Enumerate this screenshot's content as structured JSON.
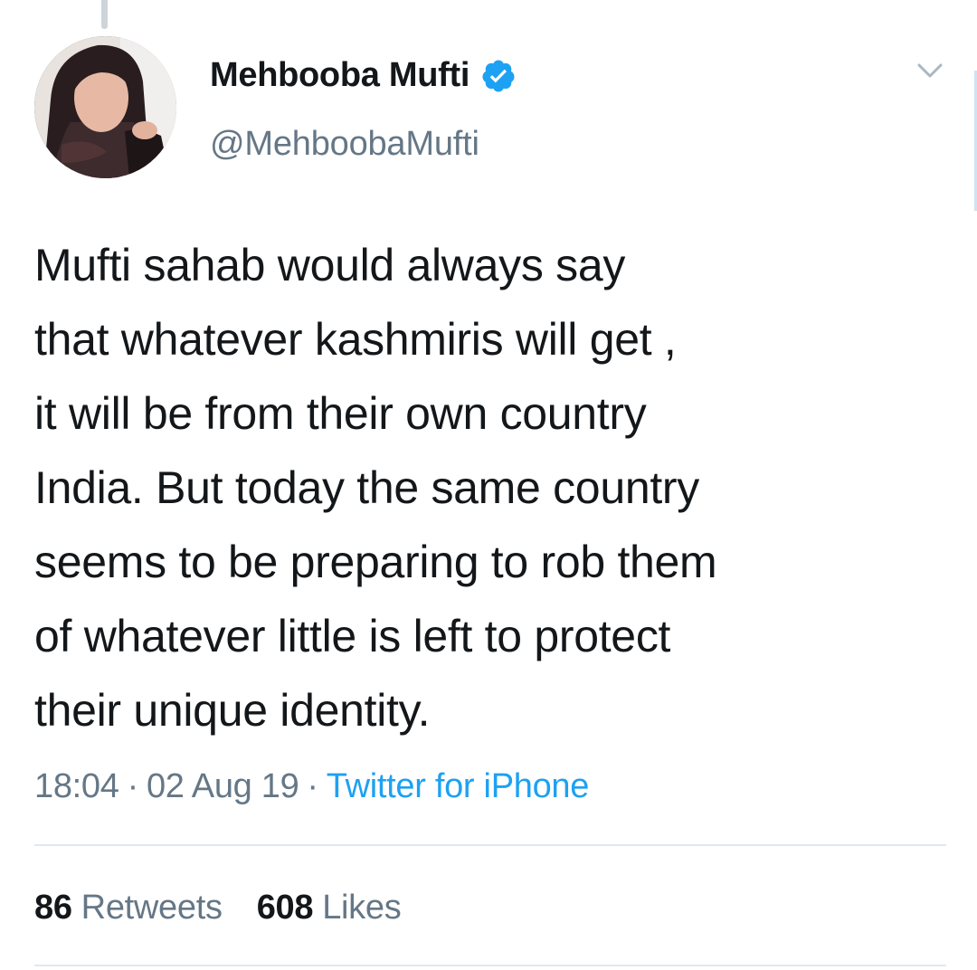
{
  "tweet": {
    "author": {
      "display_name": "Mehbooba Mufti",
      "handle": "@MehboobaMufti",
      "verified": true
    },
    "text_lines": [
      "Mufti sahab would always say",
      "that whatever kashmiris will get ,",
      "it will be from their own country",
      "India. But today the same country",
      "seems to be preparing to rob them",
      "of whatever little is left to protect",
      "their unique identity."
    ],
    "meta": {
      "time": "18:04",
      "separator": "·",
      "date": "02 Aug 19",
      "source": "Twitter for iPhone"
    },
    "stats": {
      "retweets_count": "86",
      "retweets_label": "Retweets",
      "likes_count": "608",
      "likes_label": "Likes"
    }
  },
  "icons": {
    "verified": "verified-badge-icon",
    "caret": "chevron-down-icon"
  },
  "colors": {
    "text": "#14171a",
    "secondary": "#657786",
    "accent": "#1da1f2",
    "divider": "#e1e8ed"
  }
}
